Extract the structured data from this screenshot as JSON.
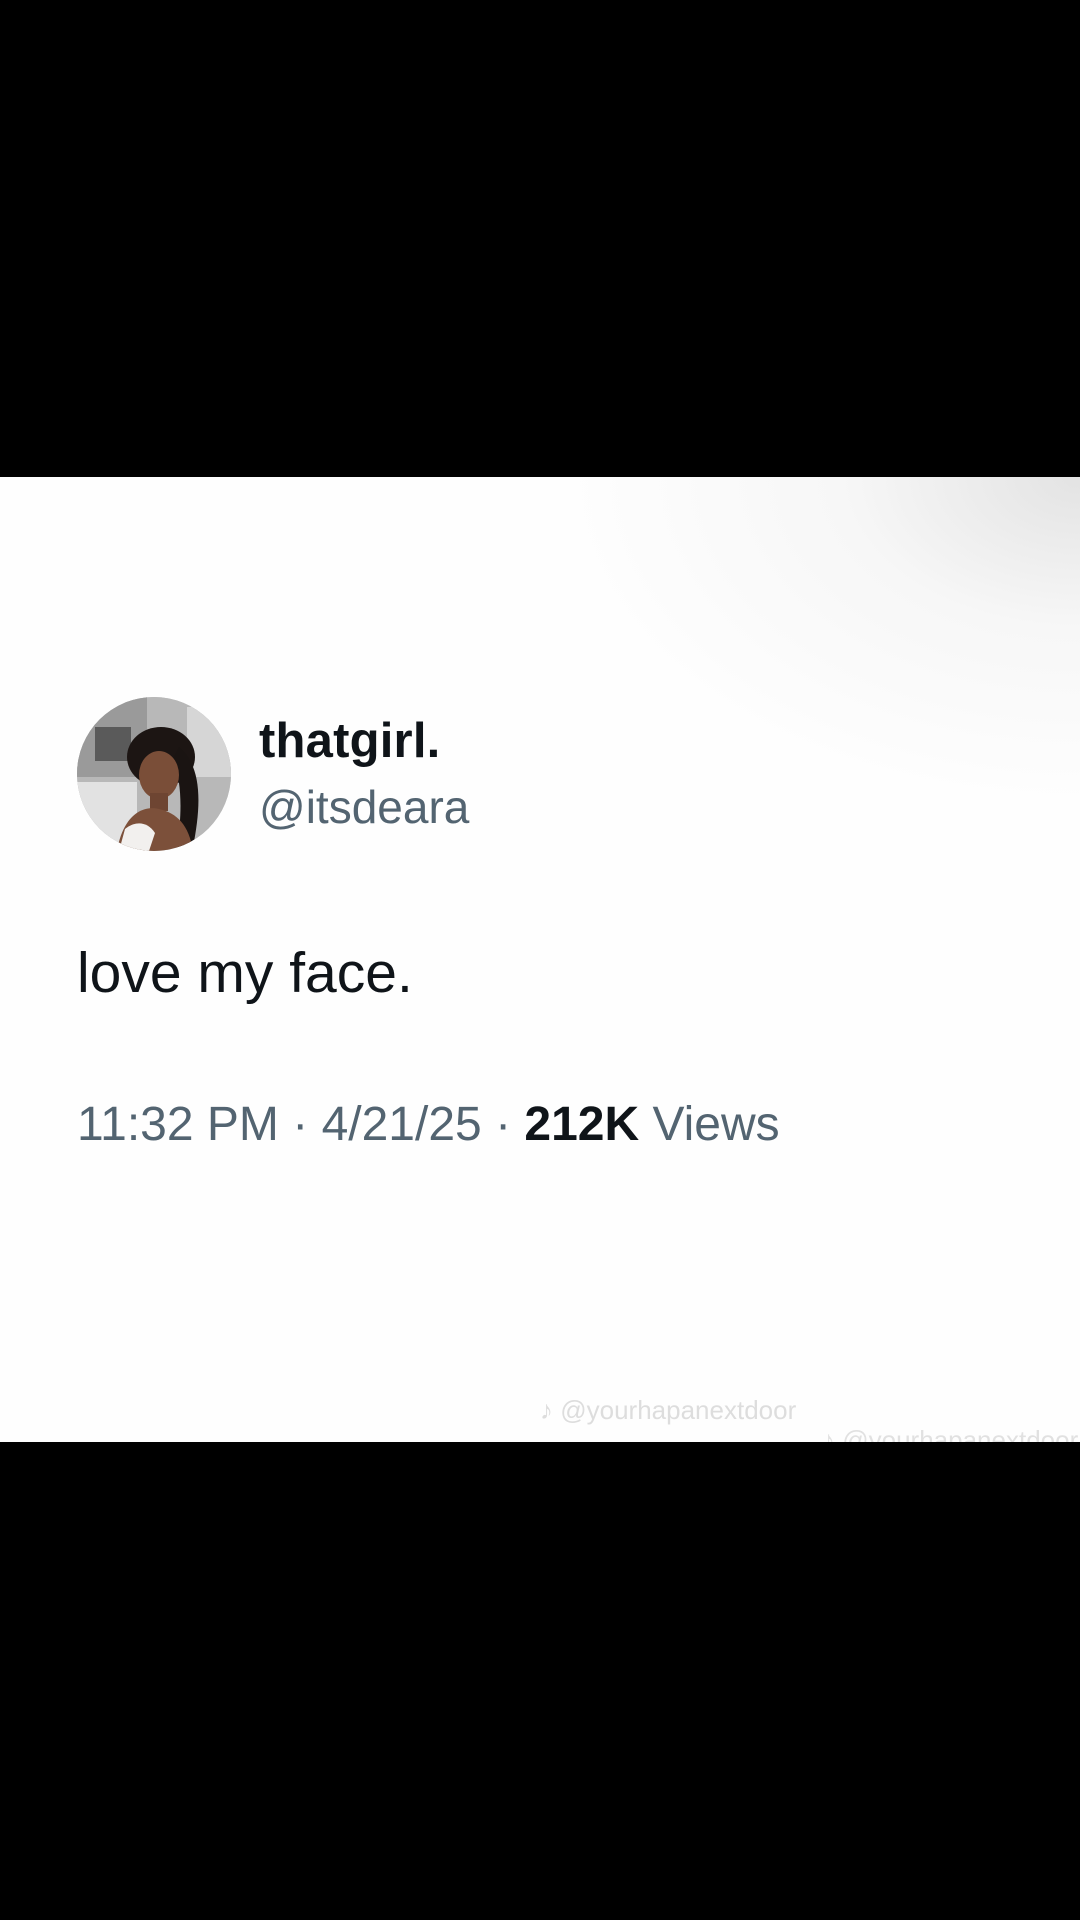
{
  "tweet": {
    "display_name": "thatgirl.",
    "handle": "@itsdeara",
    "text": "love my face.",
    "time": "11:32 PM",
    "separator": "·",
    "date": "4/21/25",
    "views_count": "212K",
    "views_label": "Views"
  },
  "watermark": {
    "text": "@yourhapanextdoor",
    "icon": "tiktok-icon"
  },
  "colors": {
    "letterbox": "#000000",
    "card_background": "#fefefe",
    "primary_text": "#0f1419",
    "secondary_text": "#536471"
  }
}
